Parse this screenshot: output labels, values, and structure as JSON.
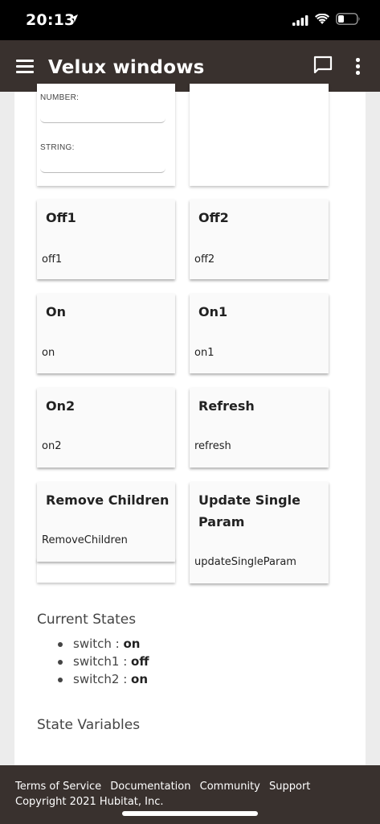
{
  "status_bar": {
    "time": "20:13"
  },
  "app_bar": {
    "title": "Velux windows"
  },
  "partial_card": {
    "number_label": "NUMBER:",
    "string_label": "STRING:"
  },
  "commands": [
    {
      "title": "Off1",
      "command": "off1"
    },
    {
      "title": "Off2",
      "command": "off2"
    },
    {
      "title": "On",
      "command": "on"
    },
    {
      "title": "On1",
      "command": "on1"
    },
    {
      "title": "On2",
      "command": "on2"
    },
    {
      "title": "Refresh",
      "command": "refresh"
    },
    {
      "title": "Remove Children",
      "command": "RemoveChildren"
    },
    {
      "title": "Update Single Param",
      "command": "updateSingleParam"
    }
  ],
  "current_states": {
    "title": "Current States",
    "items": [
      {
        "name": "switch",
        "value": "on"
      },
      {
        "name": "switch1",
        "value": "off"
      },
      {
        "name": "switch2",
        "value": "on"
      }
    ]
  },
  "state_variables": {
    "title": "State Variables"
  },
  "footer": {
    "links": [
      "Terms of Service",
      "Documentation",
      "Community",
      "Support"
    ],
    "copyright": "Copyright 2021 Hubitat, Inc."
  }
}
